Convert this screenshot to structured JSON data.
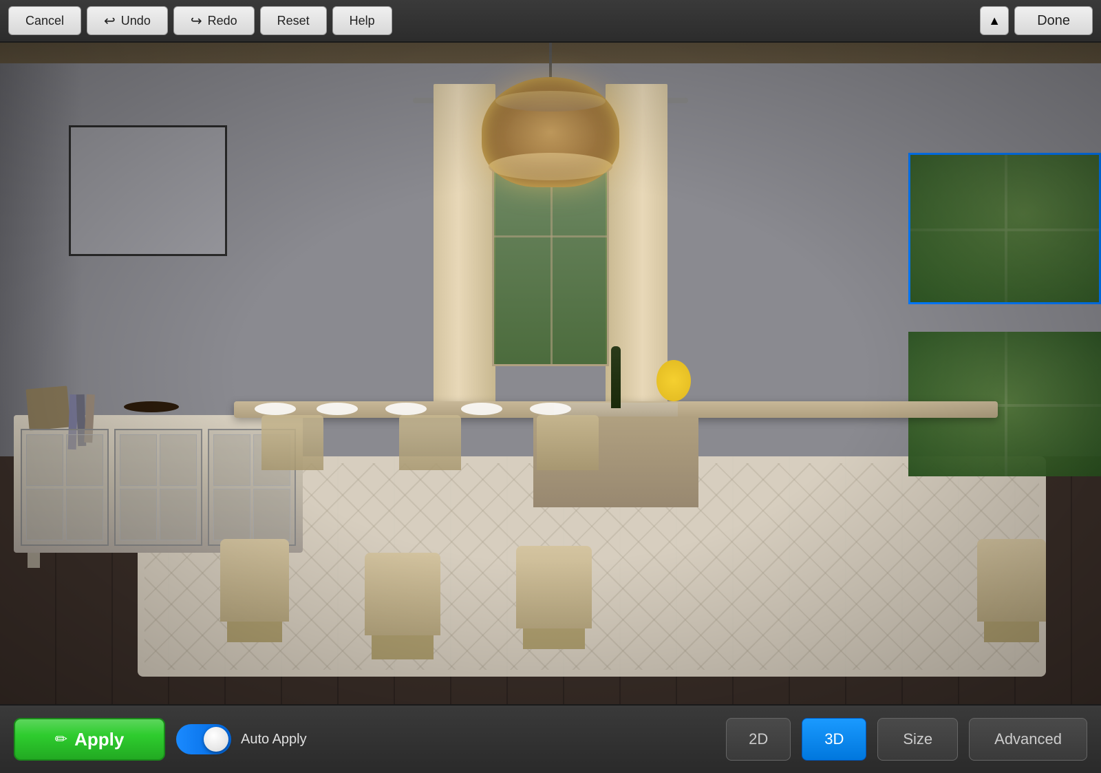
{
  "toolbar": {
    "cancel_label": "Cancel",
    "undo_label": "Undo",
    "redo_label": "Redo",
    "reset_label": "Reset",
    "help_label": "Help",
    "done_label": "Done",
    "collapse_icon": "▲"
  },
  "bottom_toolbar": {
    "apply_label": "Apply",
    "apply_icon": "✏️",
    "auto_apply_label": "Auto Apply",
    "mode_2d_label": "2D",
    "mode_3d_label": "3D",
    "size_label": "Size",
    "advanced_label": "Advanced"
  },
  "scene": {
    "description": "Dining room 3D view with table, chairs, chandelier, windows"
  }
}
